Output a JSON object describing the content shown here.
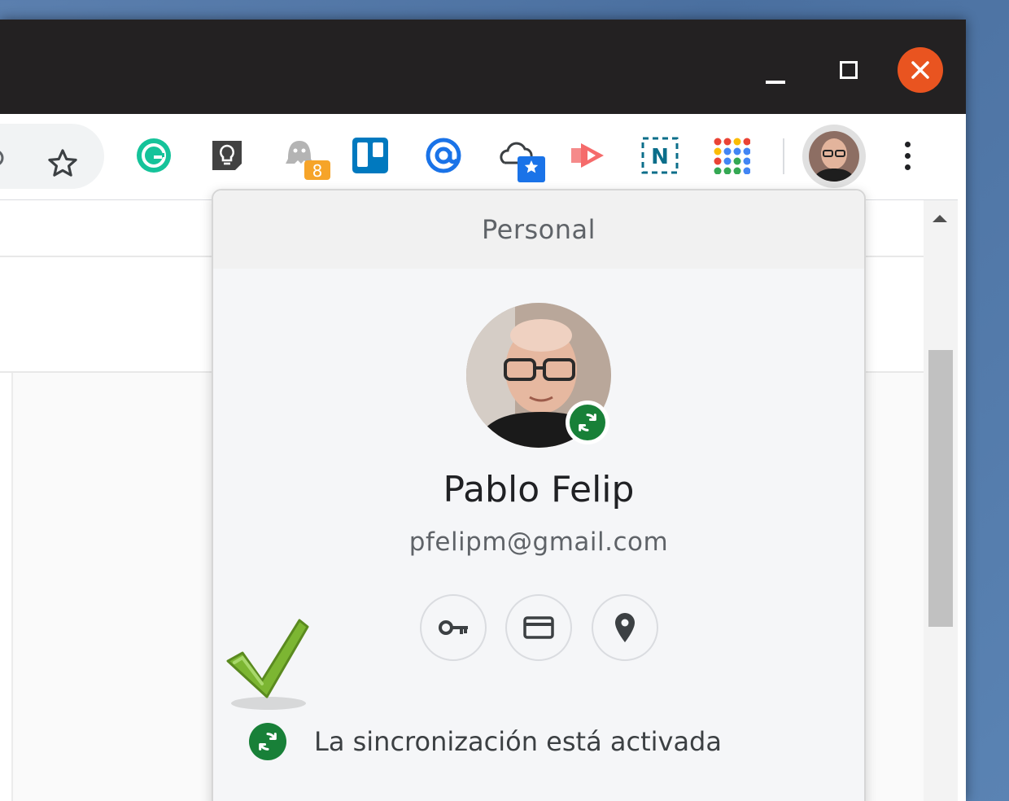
{
  "profile_menu": {
    "header": "Personal",
    "name": "Pablo Felip",
    "email": "pfelipm@gmail.com",
    "sync_status": "La sincronización está activada"
  },
  "toolbar": {
    "extension_badge": "8",
    "extensions": [
      "grammarly-icon",
      "lightbulb-icon",
      "ghostery-icon",
      "trello-icon",
      "at-sign-icon",
      "cloud-star-icon",
      "arrow-extension-icon",
      "n-extension-icon",
      "google-apps-icon"
    ]
  },
  "colors": {
    "titlebar": "#232122",
    "close": "#e95420",
    "sync_green": "#188038"
  }
}
